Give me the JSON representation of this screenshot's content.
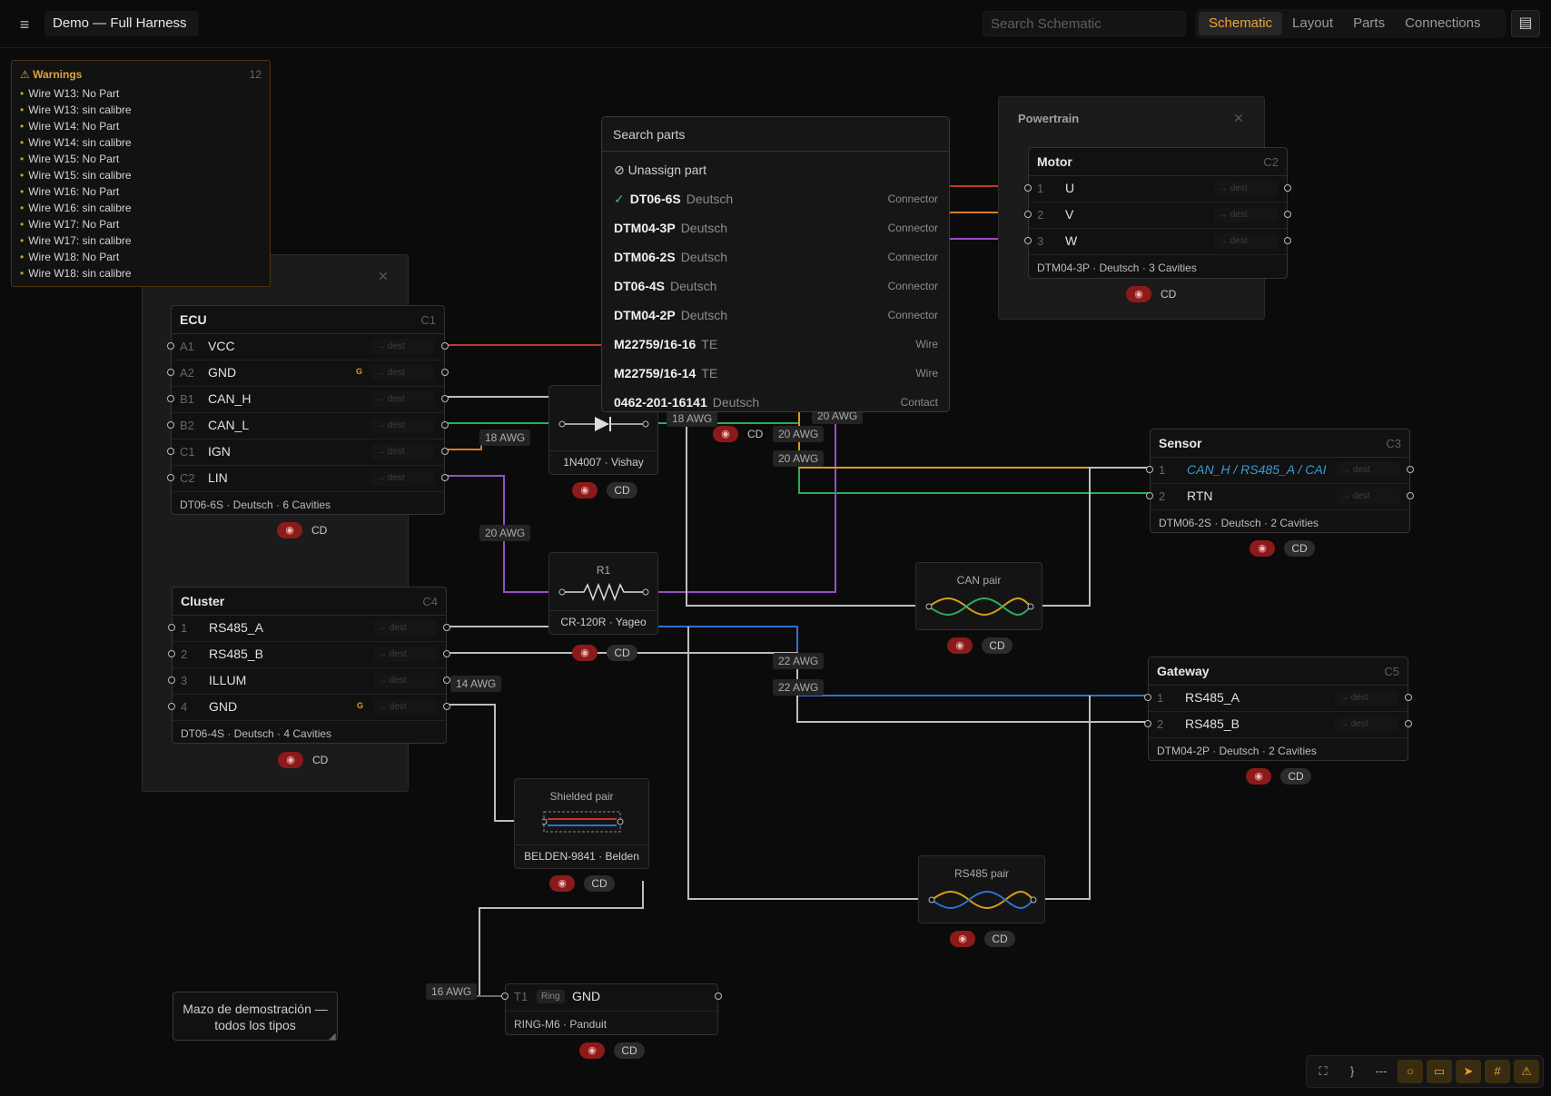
{
  "header": {
    "title": "Demo — Full Harness",
    "search_placeholder": "Search Schematic",
    "tabs": [
      {
        "label": "Schematic",
        "active": true
      },
      {
        "label": "Layout"
      },
      {
        "label": "Parts"
      },
      {
        "label": "Connections"
      }
    ]
  },
  "warnings": {
    "title": "Warnings",
    "count": "12",
    "items": [
      "Wire W13: No Part",
      "Wire W13: sin calibre",
      "Wire W14: No Part",
      "Wire W14: sin calibre",
      "Wire W15: No Part",
      "Wire W15: sin calibre",
      "Wire W16: No Part",
      "Wire W16: sin calibre",
      "Wire W17: No Part",
      "Wire W17: sin calibre",
      "Wire W18: No Part",
      "Wire W18: sin calibre"
    ]
  },
  "parts_dropdown": {
    "search_placeholder": "Search parts",
    "unassign": "Unassign part",
    "selected_icon": "check-icon",
    "items": [
      {
        "name": "DT06-6S",
        "maker": "Deutsch",
        "kind": "Connector",
        "selected": true
      },
      {
        "name": "DTM04-3P",
        "maker": "Deutsch",
        "kind": "Connector"
      },
      {
        "name": "DTM06-2S",
        "maker": "Deutsch",
        "kind": "Connector"
      },
      {
        "name": "DT06-4S",
        "maker": "Deutsch",
        "kind": "Connector"
      },
      {
        "name": "DTM04-2P",
        "maker": "Deutsch",
        "kind": "Connector"
      },
      {
        "name": "M22759/16-16",
        "maker": "TE",
        "kind": "Wire"
      },
      {
        "name": "M22759/16-14",
        "maker": "TE",
        "kind": "Wire"
      },
      {
        "name": "0462-201-16141",
        "maker": "Deutsch",
        "kind": "Contact"
      }
    ]
  },
  "groups": {
    "powertrain": {
      "title": "Powertrain"
    }
  },
  "connectors": {
    "ecu": {
      "name": "ECU",
      "id": "C1",
      "footer": "DT06-6S · Deutsch · 6 Cavities",
      "dest": "→ dest",
      "ground_mark": "G",
      "pins": [
        {
          "num": "A1",
          "sig": "VCC"
        },
        {
          "num": "A2",
          "sig": "GND",
          "g": true
        },
        {
          "num": "B1",
          "sig": "CAN_H"
        },
        {
          "num": "B2",
          "sig": "CAN_L"
        },
        {
          "num": "C1",
          "sig": "IGN"
        },
        {
          "num": "C2",
          "sig": "LIN"
        }
      ]
    },
    "motor": {
      "name": "Motor",
      "id": "C2",
      "footer": "DTM04-3P · Deutsch · 3 Cavities",
      "dest": "→ dest",
      "pins": [
        {
          "num": "1",
          "sig": "U"
        },
        {
          "num": "2",
          "sig": "V"
        },
        {
          "num": "3",
          "sig": "W"
        }
      ]
    },
    "sensor": {
      "name": "Sensor",
      "id": "C3",
      "footer": "DTM06-2S · Deutsch · 2 Cavities",
      "dest": "→ dest",
      "pins": [
        {
          "num": "1",
          "sig": "CAN_H / RS485_A / CAI",
          "edit": true
        },
        {
          "num": "2",
          "sig": "RTN"
        }
      ]
    },
    "cluster": {
      "name": "Cluster",
      "id": "C4",
      "footer": "DT06-4S · Deutsch · 4 Cavities",
      "dest": "→ dest",
      "ground_mark": "G",
      "pins": [
        {
          "num": "1",
          "sig": "RS485_A"
        },
        {
          "num": "2",
          "sig": "RS485_B"
        },
        {
          "num": "3",
          "sig": "ILLUM"
        },
        {
          "num": "4",
          "sig": "GND",
          "g": true
        }
      ]
    },
    "gateway": {
      "name": "Gateway",
      "id": "C5",
      "footer": "DTM04-2P · Deutsch · 2 Cavities",
      "dest": "→ dest",
      "pins": [
        {
          "num": "1",
          "sig": "RS485_A"
        },
        {
          "num": "2",
          "sig": "RS485_B"
        }
      ]
    }
  },
  "components": {
    "diode": {
      "footer": "1N4007 · Vishay"
    },
    "resistor": {
      "title": "R1",
      "footer": "CR-120R · Yageo"
    },
    "can_pair": {
      "title": "CAN pair"
    },
    "rs485_pair": {
      "title": "RS485 pair"
    },
    "shielded": {
      "title": "Shielded pair",
      "footer": "BELDEN-9841 · Belden"
    },
    "ring": {
      "num": "T1",
      "type": "Ring",
      "sig": "GND",
      "footer": "RING-M6 · Panduit"
    }
  },
  "badge_label": "CD",
  "awg": {
    "a18": "18 AWG",
    "a18b": "18 AWG",
    "a20a": "20 AWG",
    "a20b": "20 AWG",
    "a20c": "20 AWG",
    "a20d": "20 AWG",
    "a14": "14 AWG",
    "a22a": "22 AWG",
    "a22b": "22 AWG",
    "a16": "16 AWG"
  },
  "note": "Mazo de demostración — todos los tipos",
  "colors": {
    "accent": "#f0a33a",
    "red_wire": "#c0392b",
    "orange_wire": "#d87a2a",
    "purple_wire": "#9b4dca",
    "green_wire": "#27ae60",
    "yellow_wire": "#d4a017",
    "blue_wire": "#2f6fd6",
    "gray_wire": "#bdbdbd",
    "warning": "#e0a53a"
  },
  "toolbar": [
    {
      "icon": "fit-icon",
      "glyph": "⛶"
    },
    {
      "icon": "brace-icon",
      "glyph": "}"
    },
    {
      "icon": "dash-icon",
      "glyph": "---"
    },
    {
      "icon": "circle-icon",
      "glyph": "○",
      "on": true
    },
    {
      "icon": "rect-icon",
      "glyph": "▭",
      "on": true
    },
    {
      "icon": "arrow-icon",
      "glyph": "➤",
      "on": true
    },
    {
      "icon": "grid-icon",
      "glyph": "#",
      "on": true
    },
    {
      "icon": "warning-icon",
      "glyph": "⚠",
      "on": true
    }
  ]
}
